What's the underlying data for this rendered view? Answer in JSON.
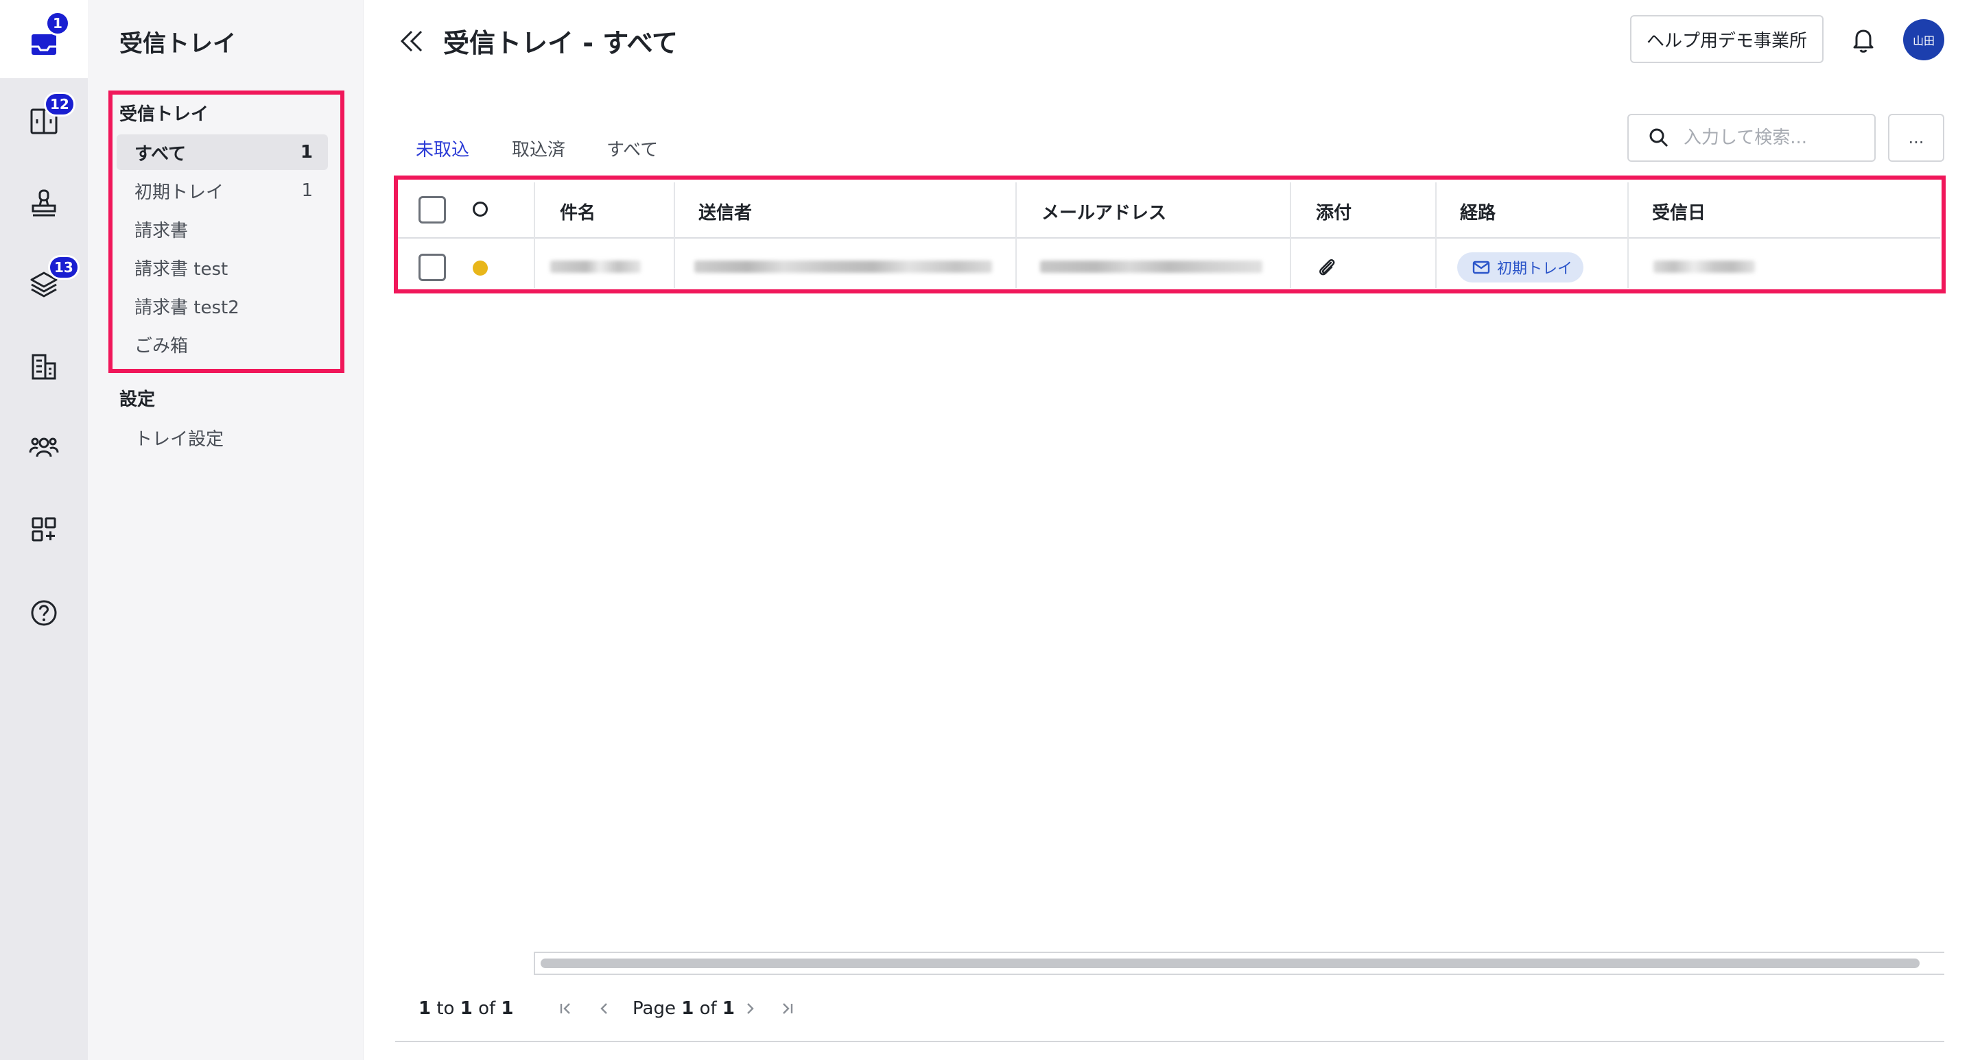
{
  "rail": {
    "items": [
      {
        "name": "inbox",
        "badge": "1"
      },
      {
        "name": "sort",
        "badge": "12"
      },
      {
        "name": "stamp",
        "badge": ""
      },
      {
        "name": "layers",
        "badge": "13"
      },
      {
        "name": "building",
        "badge": ""
      },
      {
        "name": "users",
        "badge": ""
      },
      {
        "name": "apps-add",
        "badge": ""
      },
      {
        "name": "help",
        "badge": ""
      }
    ]
  },
  "sidebar": {
    "title": "受信トレイ",
    "inbox_section": "受信トレイ",
    "items": [
      {
        "label": "すべて",
        "count": "1"
      },
      {
        "label": "初期トレイ",
        "count": "1"
      },
      {
        "label": "請求書",
        "count": ""
      },
      {
        "label": "請求書 test",
        "count": ""
      },
      {
        "label": "請求書 test2",
        "count": ""
      },
      {
        "label": "ごみ箱",
        "count": ""
      }
    ],
    "settings_section": "設定",
    "settings_items": [
      {
        "label": "トレイ設定"
      }
    ]
  },
  "header": {
    "title": "受信トレイ - すべて",
    "office_button": "ヘルプ用デモ事業所",
    "avatar_initials": "山田"
  },
  "tabs": [
    {
      "label": "未取込",
      "active": true
    },
    {
      "label": "取込済",
      "active": false
    },
    {
      "label": "すべて",
      "active": false
    }
  ],
  "search": {
    "placeholder": "入力して検索...",
    "more_label": "..."
  },
  "table": {
    "columns": [
      "件名",
      "送信者",
      "メールアドレス",
      "添付",
      "経路",
      "受信日"
    ],
    "rows": [
      {
        "route": "初期トレイ",
        "status_color": "#e8b61a"
      }
    ]
  },
  "pager": {
    "from": "1",
    "to_label": "to",
    "to": "1",
    "of_label": "of",
    "total": "1",
    "page_label": "Page",
    "page": "1",
    "page_of_label": "of",
    "pages": "1"
  }
}
